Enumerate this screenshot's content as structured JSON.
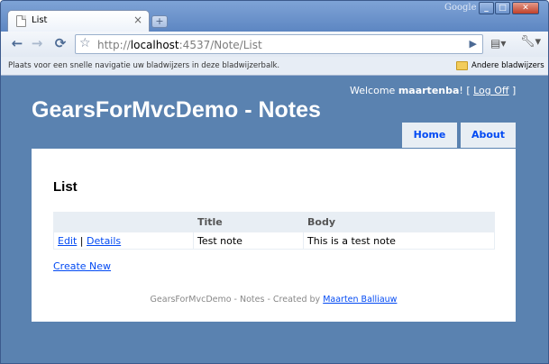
{
  "browser": {
    "tab_title": "List",
    "tab_close": "×",
    "new_tab": "+",
    "brand": "Google",
    "window_buttons": [
      "_",
      "□",
      "✕"
    ],
    "url_prefix": "http://",
    "url_host": "localhost",
    "url_rest": ":4537/Note/List",
    "bookmarks_hint": "Plaats voor een snelle navigatie uw bladwijzers in deze bladwijzerbalk.",
    "other_bookmarks": "Andere bladwijzers"
  },
  "header": {
    "welcome_prefix": "Welcome ",
    "username": "maartenba",
    "welcome_suffix": "! [ ",
    "logoff": "Log Off",
    "bracket_close": " ]",
    "site_title": "GearsForMvcDemo - Notes",
    "menu": [
      "Home",
      "About"
    ]
  },
  "content": {
    "heading": "List",
    "columns": [
      "",
      "Title",
      "Body"
    ],
    "rows": [
      {
        "edit": "Edit",
        "sep": " | ",
        "details": "Details",
        "title": "Test note",
        "body": "This is a test note"
      }
    ],
    "create_link": "Create New"
  },
  "footer": {
    "text": "GearsForMvcDemo - Notes - Created by ",
    "author": "Maarten Balliauw"
  },
  "colors": {
    "page_bg": "#5a82b0",
    "link": "#034af3",
    "header_row": "#e8eef4"
  }
}
